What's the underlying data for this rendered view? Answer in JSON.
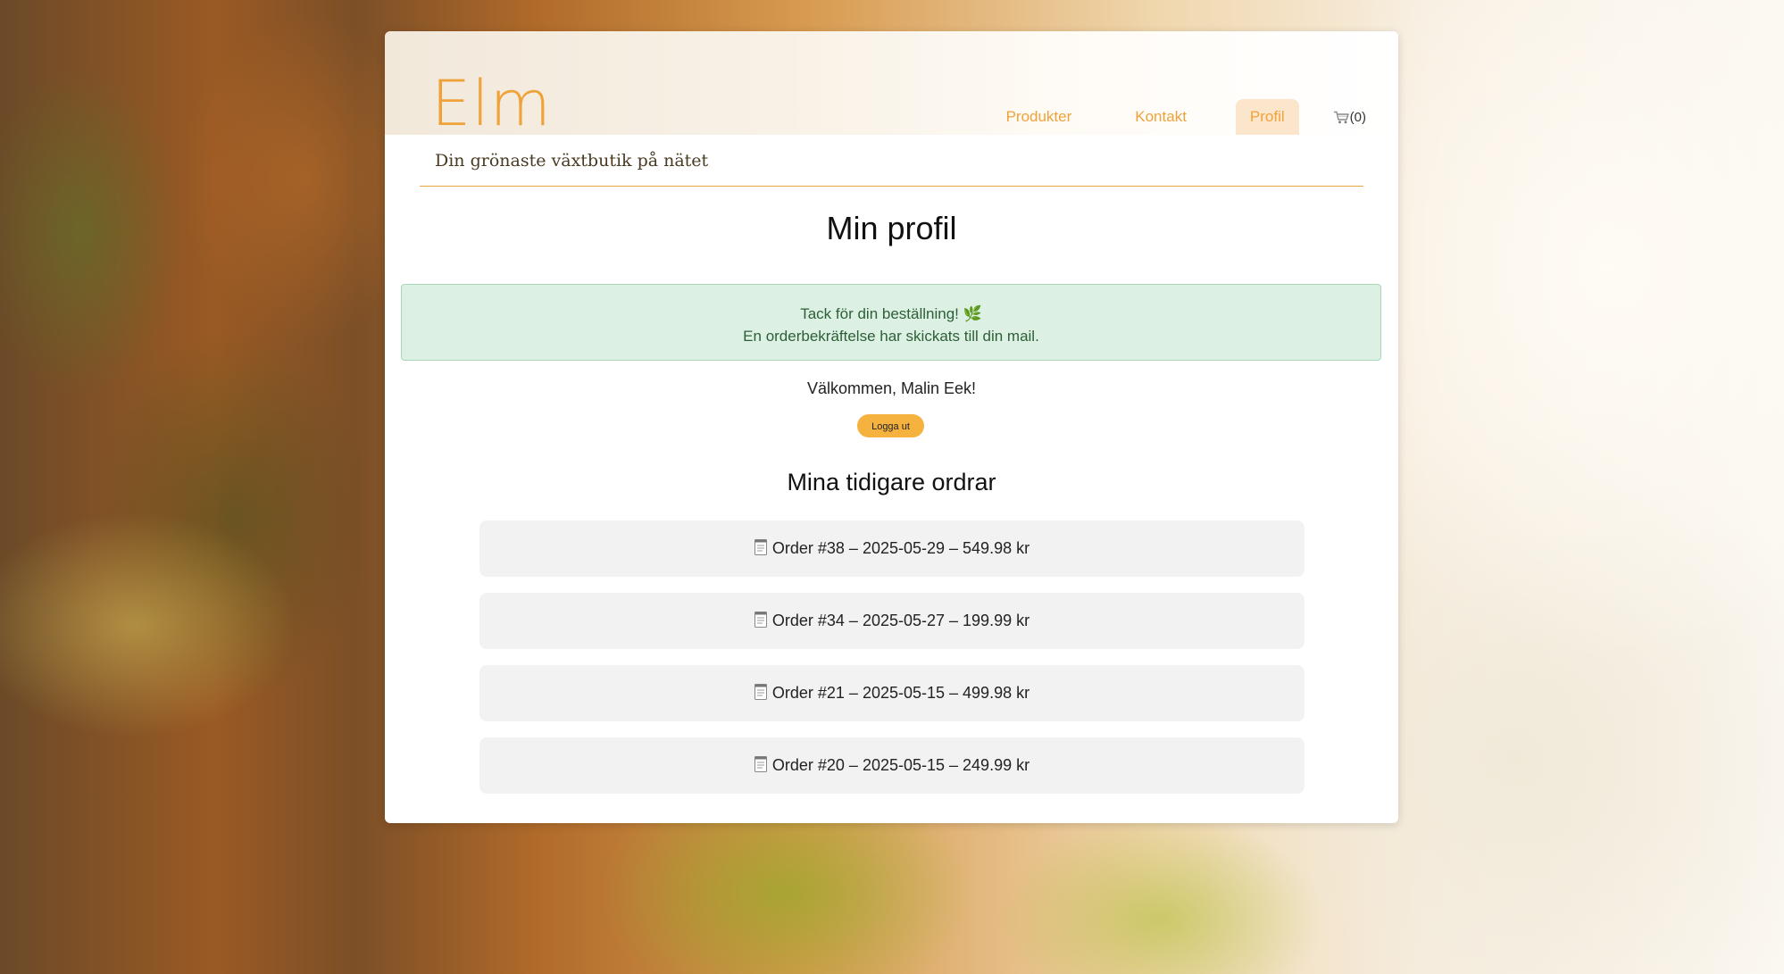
{
  "brand": {
    "logo": "Elm",
    "tagline": "Din grönaste växtbutik på nätet"
  },
  "nav": {
    "items": [
      {
        "label": "Produkter",
        "active": false
      },
      {
        "label": "Kontakt",
        "active": false
      },
      {
        "label": "Profil",
        "active": true
      }
    ],
    "cart_count": "(0)",
    "cart_icon": "shopping-cart-icon"
  },
  "page": {
    "title": "Min profil"
  },
  "alert": {
    "line1": "Tack för din beställning! 🌿",
    "line2": "En orderbekräftelse har skickats till din mail."
  },
  "user": {
    "welcome": "Välkommen, Malin Eek!",
    "logout_label": "Logga ut"
  },
  "orders": {
    "title": "Mina tidigare ordrar",
    "icon": "receipt-icon",
    "items": [
      {
        "label": "Order #38 – 2025-05-29 – 549.98 kr"
      },
      {
        "label": "Order #34 – 2025-05-27 – 199.99 kr"
      },
      {
        "label": "Order #21 – 2025-05-15 – 499.98 kr"
      },
      {
        "label": "Order #20 – 2025-05-15 – 249.99 kr"
      }
    ]
  },
  "colors": {
    "accent": "#f0a23a",
    "alert_bg": "#ddf0e4",
    "alert_text": "#2d5f36",
    "button": "#f5b23f"
  }
}
